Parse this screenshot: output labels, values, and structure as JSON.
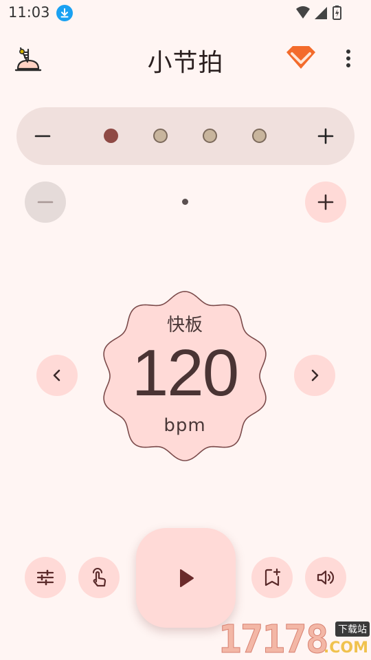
{
  "status_bar": {
    "time": "11:03"
  },
  "app_bar": {
    "title": "小节拍"
  },
  "beats": {
    "decrease_label": "−",
    "increase_label": "+",
    "states": [
      "active",
      "inactive",
      "inactive",
      "inactive"
    ]
  },
  "subdivision": {
    "decrease_label": "−",
    "increase_label": "+"
  },
  "tempo": {
    "name": "快板",
    "bpm": "120",
    "unit": "bpm"
  },
  "watermark": {
    "number": "17178",
    "tag": "下载站",
    "suffix": ".COM"
  },
  "colors": {
    "background": "#fff5f3",
    "accent_pink": "#ffdad7",
    "beat_active": "#8f4a45",
    "beat_inactive": "#c8b59d",
    "icon_dark": "#5a2a2a",
    "premium_orange": "#f36b2b"
  }
}
